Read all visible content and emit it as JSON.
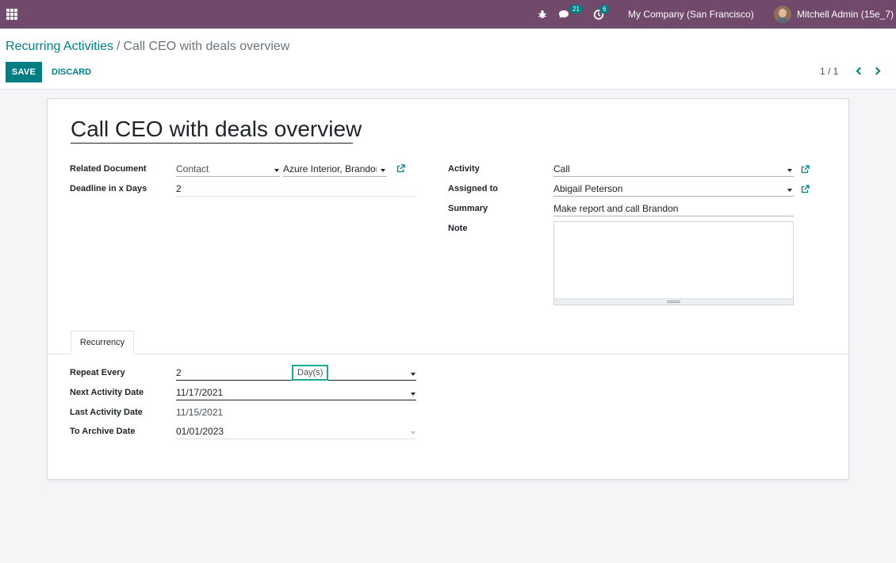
{
  "navbar": {
    "messages_count": "21",
    "activities_count": "6",
    "company": "My Company (San Francisco)",
    "user": "Mitchell Admin (15e_7)"
  },
  "breadcrumb": {
    "parent": "Recurring Activities",
    "separator": "/",
    "current": "Call CEO with deals overview"
  },
  "actions": {
    "save": "SAVE",
    "discard": "DISCARD"
  },
  "pager": {
    "value": "1 / 1"
  },
  "form": {
    "title": "Call CEO with deals overview",
    "related_document": {
      "label": "Related Document",
      "model": "Contact",
      "record": "Azure Interior, Brandon F"
    },
    "deadline_days": {
      "label": "Deadline in x Days",
      "value": "2"
    },
    "activity": {
      "label": "Activity",
      "value": "Call"
    },
    "assigned_to": {
      "label": "Assigned to",
      "value": "Abigail Peterson"
    },
    "summary": {
      "label": "Summary",
      "value": "Make report and call Brandon"
    },
    "note": {
      "label": "Note",
      "value": ""
    }
  },
  "tabs": [
    {
      "label": "Recurrency",
      "active": true
    }
  ],
  "recurrency": {
    "repeat_every": {
      "label": "Repeat Every",
      "value": "2",
      "unit": "Day(s)"
    },
    "next_activity_date": {
      "label": "Next Activity Date",
      "value": "11/17/2021"
    },
    "last_activity_date": {
      "label": "Last Activity Date",
      "value": "11/15/2021"
    },
    "to_archive_date": {
      "label": "To Archive Date",
      "value": "01/01/2023"
    }
  },
  "colors": {
    "navbar": "#71496a",
    "primary": "#017e84",
    "focus_border": "#1ea896",
    "background": "#f5f5f8"
  }
}
